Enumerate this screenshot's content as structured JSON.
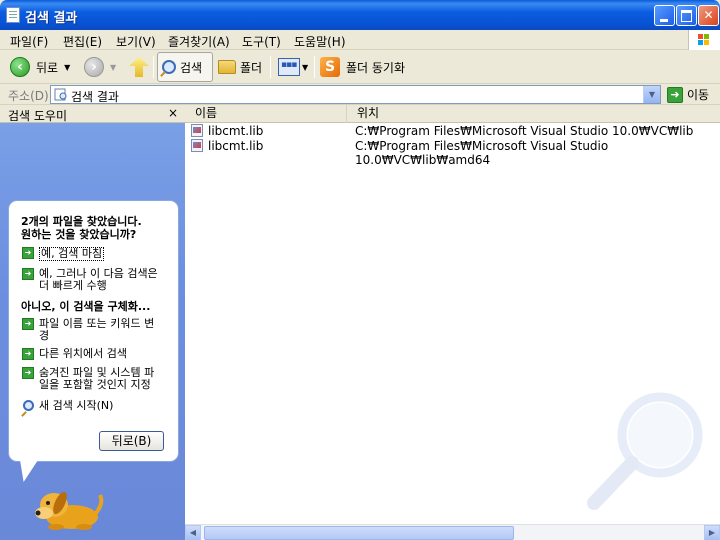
{
  "window": {
    "title": "검색 결과"
  },
  "menu": {
    "file": "파일(F)",
    "edit": "편집(E)",
    "view": "보기(V)",
    "favorites": "즐겨찾기(A)",
    "tools": "도구(T)",
    "help": "도움말(H)"
  },
  "toolbar": {
    "back": "뒤로",
    "search": "검색",
    "folders": "폴더",
    "sync": "폴더 동기화"
  },
  "address": {
    "label": "주소(D)",
    "value": "검색 결과",
    "go": "이동"
  },
  "search_companion": {
    "title": "검색 도우미",
    "close": "×",
    "found_line1": "2개의 파일을 찾았습니다.",
    "found_line2": "원하는 것을 찾았습니까?",
    "opt_yes": "예, 검색 마침",
    "opt_refine_1": "예, 그러나 이 다음 검색은",
    "opt_refine_2": "더 빠르게 수행",
    "no_heading": "아니오, 이 검색을 구체화...",
    "opt_change_1": "파일 이름 또는 키워드 변",
    "opt_change_2": "경",
    "opt_other": "다른 위치에서 검색",
    "opt_hidden_1": "숨겨진 파일 및 시스템 파",
    "opt_hidden_2": "일을 포함할 것인지 지정",
    "new_search": "새 검색 시작(N)",
    "back_button": "뒤로(B)"
  },
  "list": {
    "columns": [
      "이름",
      "위치"
    ],
    "rows": [
      {
        "name": "libcmt.lib",
        "location": "C:₩Program Files₩Microsoft Visual Studio 10.0₩VC₩lib"
      },
      {
        "name": "libcmt.lib",
        "location": "C:₩Program Files₩Microsoft Visual Studio 10.0₩VC₩lib₩amd64"
      }
    ]
  },
  "colors": {
    "title_bar": "#0A5BD9",
    "pane_blue": "#7BA2E7",
    "chrome": "#ECE9D8"
  }
}
